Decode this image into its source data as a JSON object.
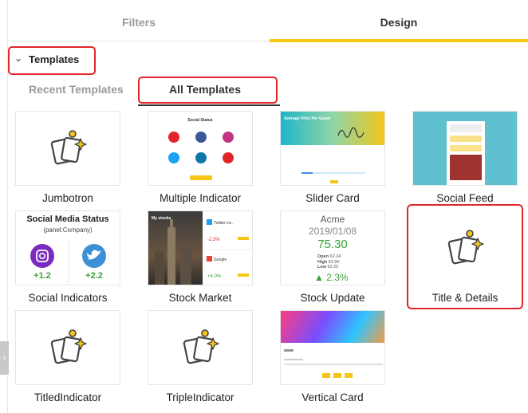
{
  "tabs": {
    "filters": "Filters",
    "design": "Design"
  },
  "section": {
    "title": "Templates"
  },
  "subtabs": {
    "recent": "Recent Templates",
    "all": "All Templates"
  },
  "templates": [
    {
      "name": "Jumbotron"
    },
    {
      "name": "Multiple Indicator"
    },
    {
      "name": "Slider Card"
    },
    {
      "name": "Social Feed"
    },
    {
      "name": "Social Indicators"
    },
    {
      "name": "Stock Market"
    },
    {
      "name": "Stock Update"
    },
    {
      "name": "Title & Details"
    },
    {
      "name": "TitledIndicator"
    },
    {
      "name": "TripleIndicator"
    },
    {
      "name": "Vertical Card"
    }
  ],
  "previews": {
    "multiple_indicator": {
      "title": "Social Status"
    },
    "slider_card": {
      "title": "Average Price Per Guest"
    },
    "social_indicators": {
      "title": "Social Media Status",
      "subtitle": "(panel:Company)",
      "instagram_value": "+1.2",
      "twitter_value": "+2.2"
    },
    "stock_market": {
      "title": "My stocks",
      "stock1_name": "Twitter inc.",
      "stock1_change": "-2.3%",
      "stock2_name": "Google",
      "stock2_change": "+4.0%"
    },
    "stock_update": {
      "company": "Acme",
      "date": "2019/01/08",
      "price": "75.30",
      "open_label": "Open",
      "open_value": "62.24",
      "high_label": "High",
      "high_value": "62.90",
      "low_label": "Low",
      "low_value": "62.20",
      "change": "2.3%"
    }
  },
  "colors": {
    "accent": "#f5c518",
    "highlight": "#e0262b",
    "positive": "#3aa33a",
    "negative": "#e0262b"
  }
}
